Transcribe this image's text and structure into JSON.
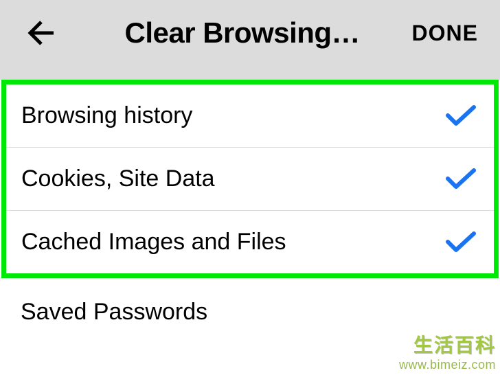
{
  "header": {
    "title": "Clear Browsing…",
    "done_label": "DONE"
  },
  "options": {
    "items": [
      {
        "label": "Browsing history",
        "checked": true
      },
      {
        "label": "Cookies, Site Data",
        "checked": true
      },
      {
        "label": "Cached Images and Files",
        "checked": true
      }
    ]
  },
  "below": {
    "label": "Saved Passwords"
  },
  "watermark": {
    "line1": "生活百科",
    "line2": "www.bimeiz.com"
  },
  "colors": {
    "highlight_border": "#00e805",
    "check": "#1a73f0",
    "header_bg": "#dcdcdd"
  }
}
